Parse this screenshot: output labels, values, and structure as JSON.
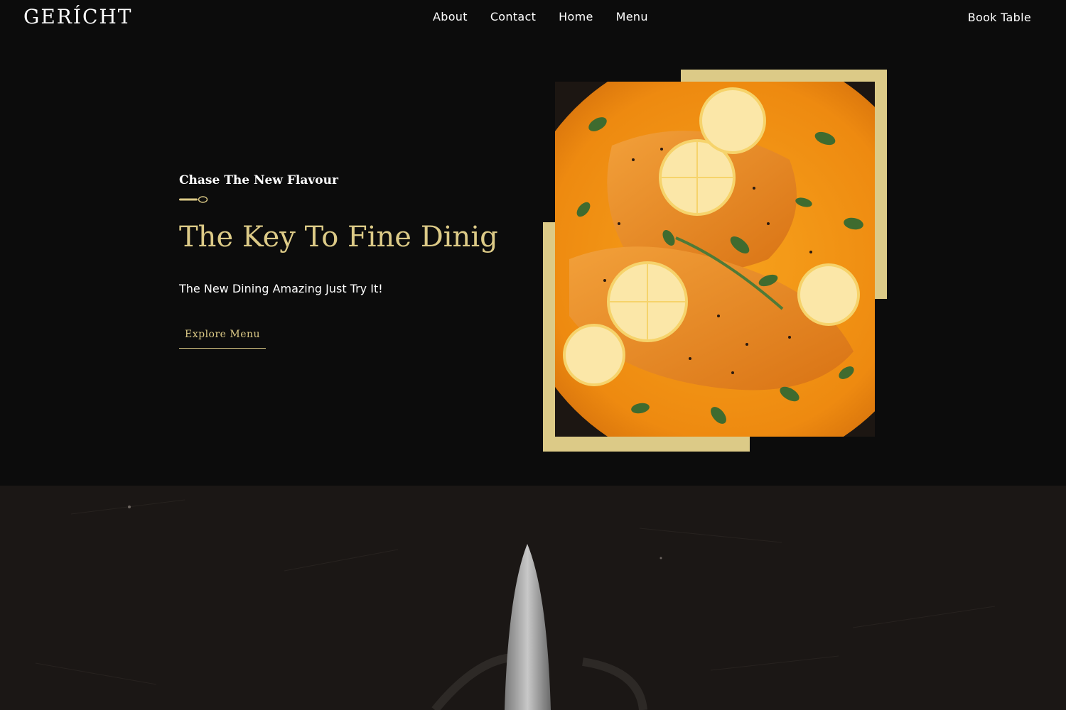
{
  "brand": {
    "logo_text": "GERÍCHT",
    "accent_color": "#dcca87",
    "background_color": "#0c0c0c"
  },
  "nav": {
    "links": [
      {
        "label": "About"
      },
      {
        "label": "Contact"
      },
      {
        "label": "Home"
      },
      {
        "label": "Menu"
      }
    ],
    "book_table_label": "Book Table"
  },
  "hero": {
    "subtitle": "Chase The New Flavour",
    "spoon_icon": "spoon-icon",
    "headline": "The Key To Fine Dinig",
    "tagline": "The New Dining Amazing Just Try It!",
    "cta_label": "Explore Menu",
    "image_icon": "salmon-dish-photo"
  },
  "lower_section": {
    "image_icon": "knife-on-dark-texture"
  }
}
